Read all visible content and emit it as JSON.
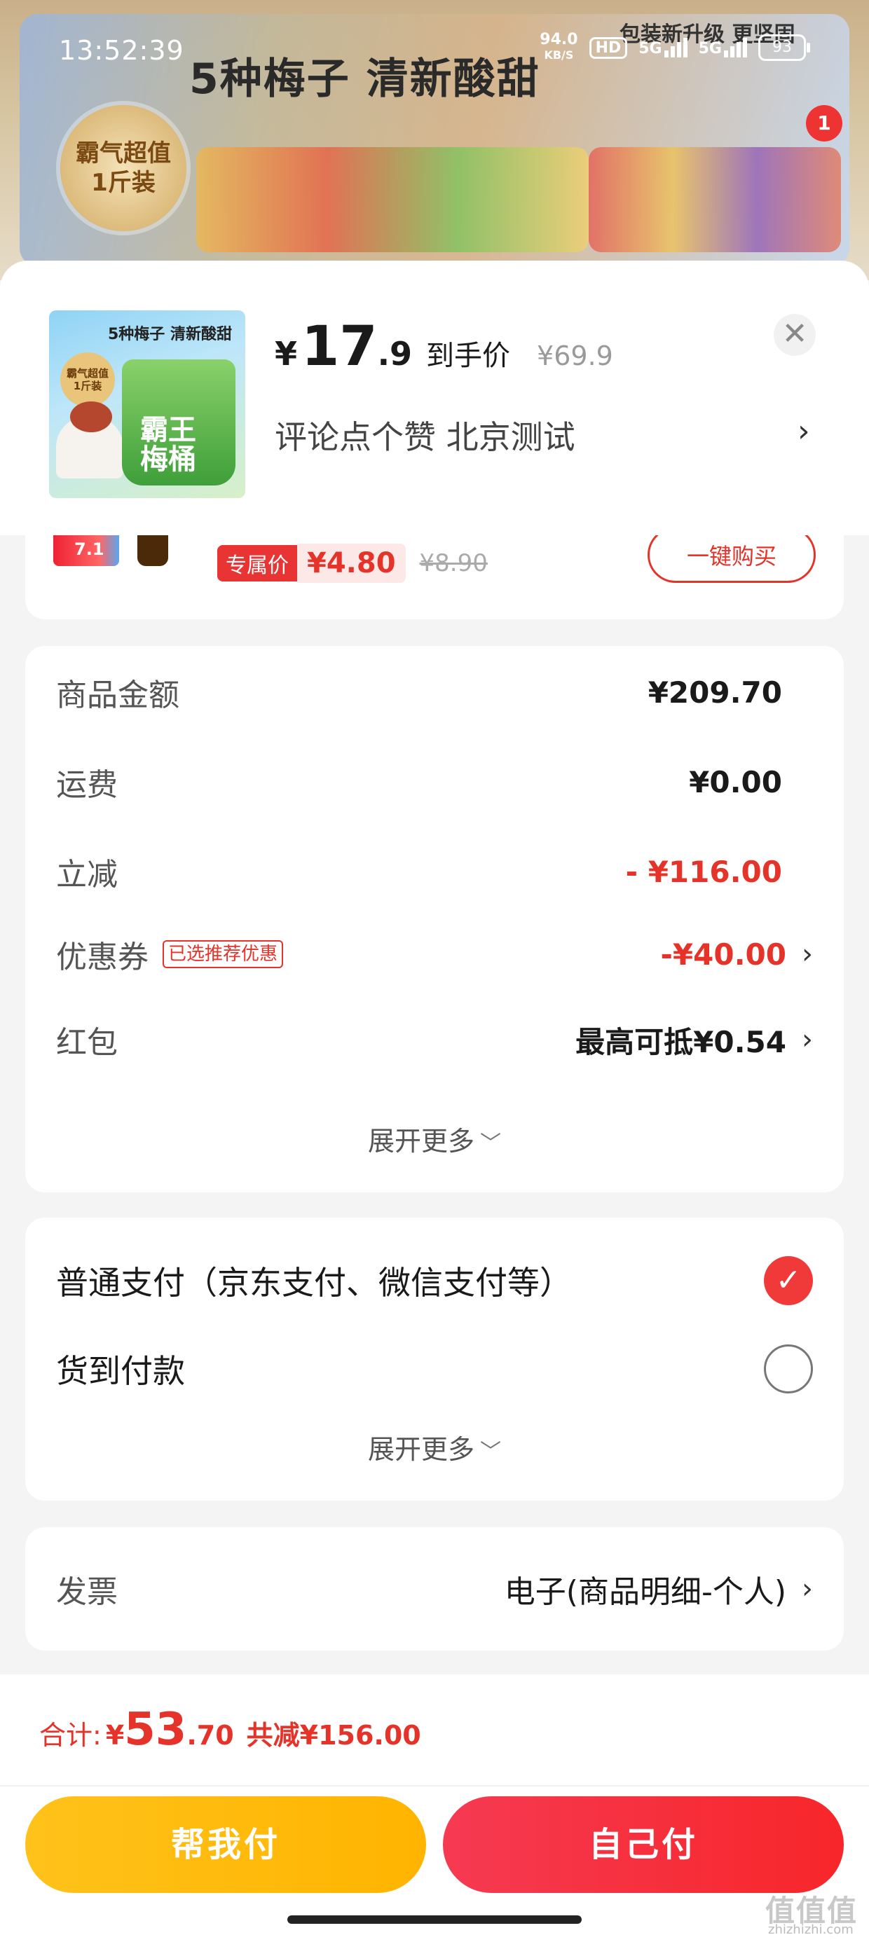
{
  "status_bar": {
    "time": "13:52:39",
    "net_speed": "94.0",
    "net_unit": "KB/S",
    "hd": "HD",
    "sim1": "5G",
    "sim2": "5G",
    "battery": "93"
  },
  "banner": {
    "title": "5种梅子 清新酸甜",
    "badge_line1": "霸气超值",
    "badge_line2": "1斤装",
    "right_title": "包装新升级 更坚固",
    "right_badge": "1"
  },
  "product": {
    "thumb_title": "5种梅子 清新酸甜",
    "thumb_badge_line1": "霸气超值",
    "thumb_badge_line2": "1斤装",
    "thumb_bucket_line1": "霸王",
    "thumb_bucket_line2": "梅桶",
    "price_symbol": "¥",
    "price_int": "17",
    "price_dec": ".9",
    "price_tag": "到手价",
    "original_price": "¥69.9",
    "spec": "评论点个赞 北京测试",
    "close_icon": "close-icon",
    "chevron": "›"
  },
  "promo": {
    "img_badge": "7.1",
    "tag_label": "专属价",
    "tag_price": "¥4.80",
    "original_price": "¥8.90",
    "buy_button": "一键购买"
  },
  "summary": {
    "rows": [
      {
        "label": "商品金额",
        "value": "¥209.70"
      },
      {
        "label": "运费",
        "value": "¥0.00"
      },
      {
        "label": "立减",
        "value": "- ¥116.00"
      },
      {
        "label": "优惠券",
        "chip": "已选推荐优惠",
        "value": "-¥40.00"
      },
      {
        "label": "红包",
        "value": "最高可抵¥0.54"
      }
    ],
    "expand": "展开更多"
  },
  "payment": {
    "options": [
      {
        "label": "普通支付（京东支付、微信支付等）",
        "selected": true
      },
      {
        "label": "货到付款",
        "selected": false
      }
    ],
    "expand": "展开更多"
  },
  "invoice": {
    "label": "发票",
    "value": "电子(商品明细-个人)"
  },
  "total": {
    "prefix": "合计:",
    "symbol": "¥",
    "int": "53",
    "dec": ".70",
    "saved": "共减¥156.00"
  },
  "buttons": {
    "help_pay": "帮我付",
    "self_pay": "自己付"
  },
  "watermark": {
    "main": "值值值",
    "sub": "zhizhizhi.com"
  },
  "colors": {
    "accent_red": "#e5332a",
    "help_yellow": "#ffb400",
    "self_red": "#f7262a"
  }
}
